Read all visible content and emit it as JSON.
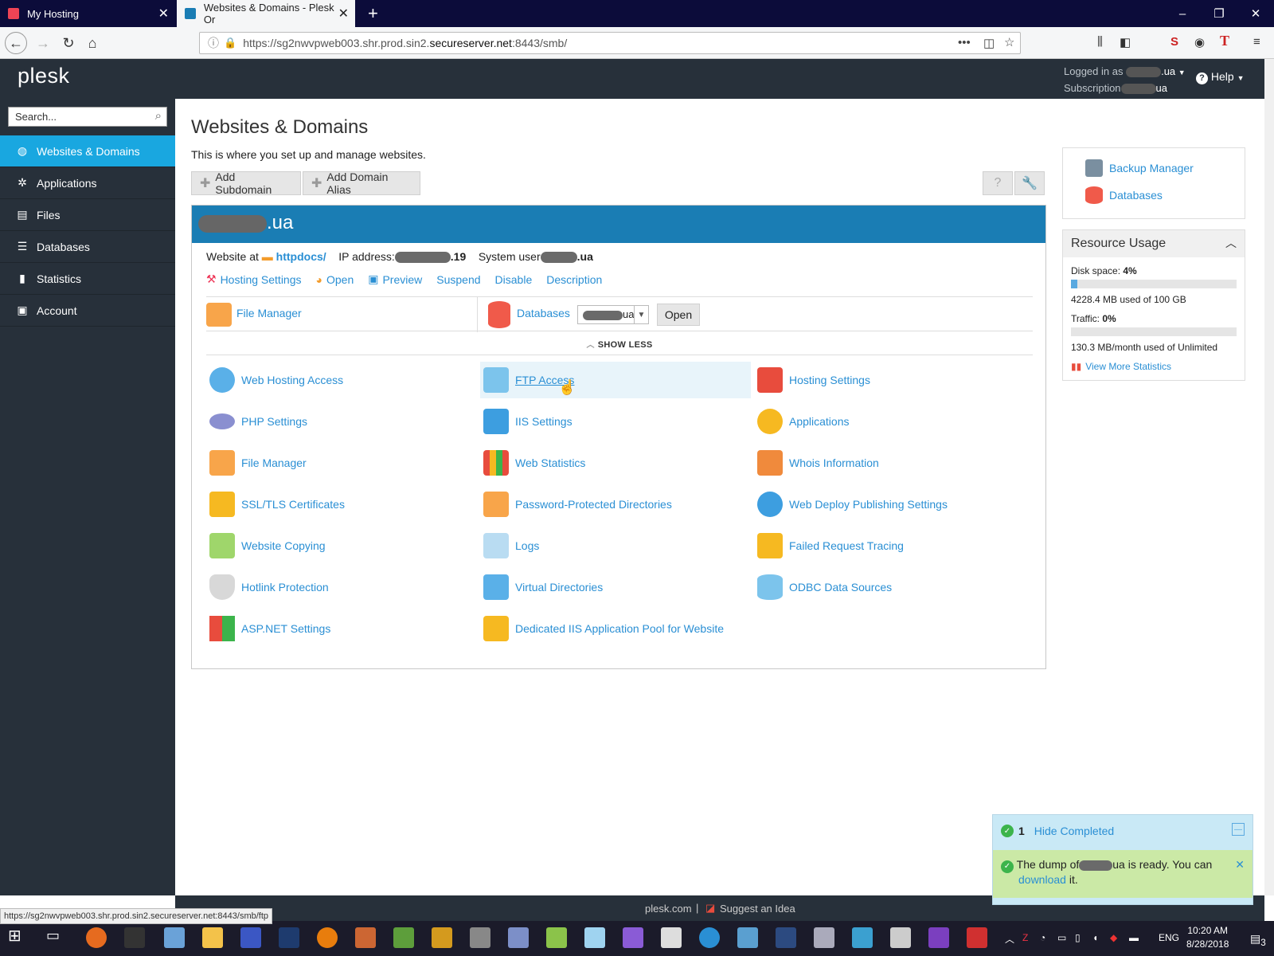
{
  "browser": {
    "tabs": [
      {
        "title": "My Hosting"
      },
      {
        "title": "Websites & Domains - Plesk Or"
      }
    ],
    "url_prefix": "https://sg2nwvpweb003.shr.prod.sin2.",
    "url_domain": "secureserver.net",
    "url_suffix": ":8443/smb/",
    "status_url": "https://sg2nwvpweb003.shr.prod.sin2.secureserver.net:8443/smb/ftp"
  },
  "header": {
    "logo": "plesk",
    "logged_in_label": "Logged in as",
    "logged_in_value": ".ua",
    "subscription_label": "Subscription",
    "subscription_value": "ua",
    "help": "Help"
  },
  "sidebar": {
    "search_placeholder": "Search...",
    "items": [
      {
        "label": "Websites & Domains",
        "icon": "globe-icon"
      },
      {
        "label": "Applications",
        "icon": "gear-icon"
      },
      {
        "label": "Files",
        "icon": "file-icon"
      },
      {
        "label": "Databases",
        "icon": "database-icon"
      },
      {
        "label": "Statistics",
        "icon": "bar-chart-icon"
      },
      {
        "label": "Account",
        "icon": "account-icon"
      }
    ]
  },
  "main": {
    "title": "Websites & Domains",
    "subtitle": "This is where you set up and manage websites.",
    "add_subdomain": "Add Subdomain",
    "add_domain_alias": "Add Domain Alias"
  },
  "domain": {
    "name_suffix": ".ua",
    "website_at": "Website at",
    "docroot": "httpdocs/",
    "ip_label": "IP address:",
    "ip_suffix": ".19",
    "sysuser_label": "System user",
    "sysuser_suffix": ".ua",
    "links": [
      "Hosting Settings",
      "Open",
      "Preview",
      "Suspend",
      "Disable",
      "Description"
    ],
    "quick_file_manager": "File Manager",
    "quick_databases": "Databases",
    "db_select_value": "ua",
    "open_button": "Open",
    "show_less": "SHOW LESS"
  },
  "tools": [
    [
      "Web Hosting Access",
      "FTP Access",
      "Hosting Settings"
    ],
    [
      "PHP Settings",
      "IIS Settings",
      "Applications"
    ],
    [
      "File Manager",
      "Web Statistics",
      "Whois Information"
    ],
    [
      "SSL/TLS Certificates",
      "Password-Protected Directories",
      "Web Deploy Publishing Settings"
    ],
    [
      "Website Copying",
      "Logs",
      "Failed Request Tracing"
    ],
    [
      "Hotlink Protection",
      "Virtual Directories",
      "ODBC Data Sources"
    ],
    [
      "ASP.NET Settings",
      "Dedicated IIS Application Pool for Website",
      ""
    ]
  ],
  "right": {
    "backup_manager": "Backup Manager",
    "databases": "Databases",
    "resource_title": "Resource Usage",
    "disk_label": "Disk space:",
    "disk_pct": "4%",
    "disk_fraction": 0.04,
    "disk_used": "4228.4 MB used of 100 GB",
    "traffic_label": "Traffic:",
    "traffic_pct": "0%",
    "traffic_fraction": 0.0,
    "traffic_used": "130.3 MB/month used of Unlimited",
    "view_more": "View More Statistics"
  },
  "footer": {
    "site": "plesk.com",
    "suggest": "Suggest an Idea"
  },
  "notification": {
    "count": "1",
    "hide": "Hide Completed",
    "msg_pre": "The dump of",
    "msg_mid": "ua is ready. You can",
    "msg_link": "download",
    "msg_post": "it."
  },
  "taskbar": {
    "time": "10:20 AM",
    "date": "8/28/2018",
    "lang": "ENG",
    "notif_count": "3"
  }
}
